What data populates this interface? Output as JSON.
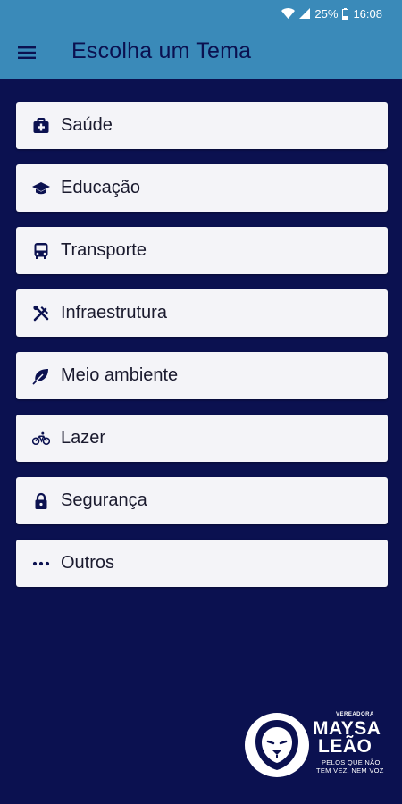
{
  "status_bar": {
    "battery": "25%",
    "time": "16:08"
  },
  "app_bar": {
    "title": "Escolha um Tema"
  },
  "topics": [
    {
      "label": "Saúde",
      "icon": "medical-kit-icon"
    },
    {
      "label": "Educação",
      "icon": "graduation-cap-icon"
    },
    {
      "label": "Transporte",
      "icon": "bus-icon"
    },
    {
      "label": "Infraestrutura",
      "icon": "tools-icon"
    },
    {
      "label": "Meio ambiente",
      "icon": "leaf-icon"
    },
    {
      "label": "Lazer",
      "icon": "bicycle-icon"
    },
    {
      "label": "Segurança",
      "icon": "lock-icon"
    },
    {
      "label": "Outros",
      "icon": "more-horizontal-icon"
    }
  ],
  "logo": {
    "vereadora": "VEREADORA",
    "name_line1": "MAYSA",
    "name_line2": "LEÃO",
    "slogan_line1": "PELOS QUE NÃO",
    "slogan_line2": "TEM VEZ, NEM VOZ"
  },
  "colors": {
    "app_bar": "#3a8ab9",
    "background": "#0b1150",
    "card": "#f4f4f8",
    "title_text": "#0b1150"
  }
}
